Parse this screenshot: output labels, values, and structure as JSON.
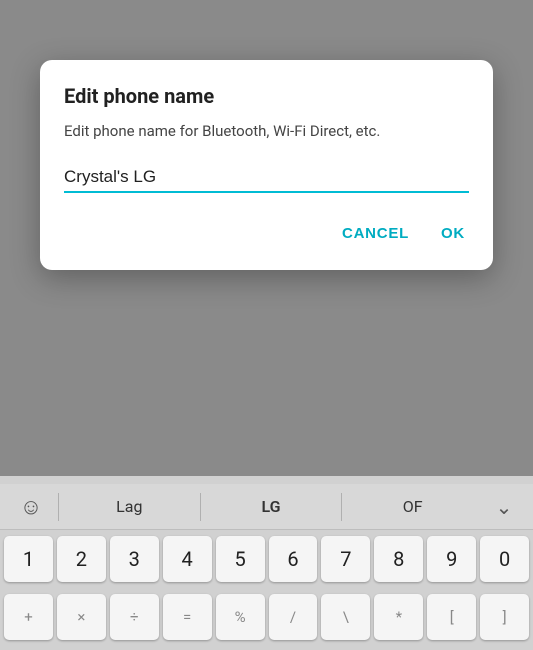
{
  "dialog": {
    "title": "Edit phone name",
    "description": "Edit phone name for Bluetooth, Wi-Fi Direct, etc.",
    "input_value": "Crystal's LG",
    "input_placeholder": "",
    "cancel_label": "CANCEL",
    "ok_label": "OK"
  },
  "keyboard": {
    "suggestions": {
      "emoji_icon": "☺",
      "word1": "Lag",
      "word2": "LG",
      "word3": "OF",
      "chevron": "⌄"
    },
    "number_row": [
      {
        "main": "1",
        "sub": ""
      },
      {
        "main": "2",
        "sub": ""
      },
      {
        "main": "3",
        "sub": ""
      },
      {
        "main": "4",
        "sub": ""
      },
      {
        "main": "5",
        "sub": ""
      },
      {
        "main": "6",
        "sub": ""
      },
      {
        "main": "7",
        "sub": ""
      },
      {
        "main": "8",
        "sub": ""
      },
      {
        "main": "9",
        "sub": ""
      },
      {
        "main": "0",
        "sub": ""
      }
    ],
    "symbol_row": [
      {
        "main": "+",
        "sub": ""
      },
      {
        "main": "×",
        "sub": ""
      },
      {
        "main": "÷",
        "sub": ""
      },
      {
        "main": "=",
        "sub": ""
      },
      {
        "main": "%",
        "sub": ""
      },
      {
        "main": "/",
        "sub": ""
      },
      {
        "main": "\\",
        "sub": ""
      },
      {
        "main": "*",
        "sub": ""
      },
      {
        "main": "[",
        "sub": ""
      },
      {
        "main": "]",
        "sub": ""
      }
    ]
  }
}
